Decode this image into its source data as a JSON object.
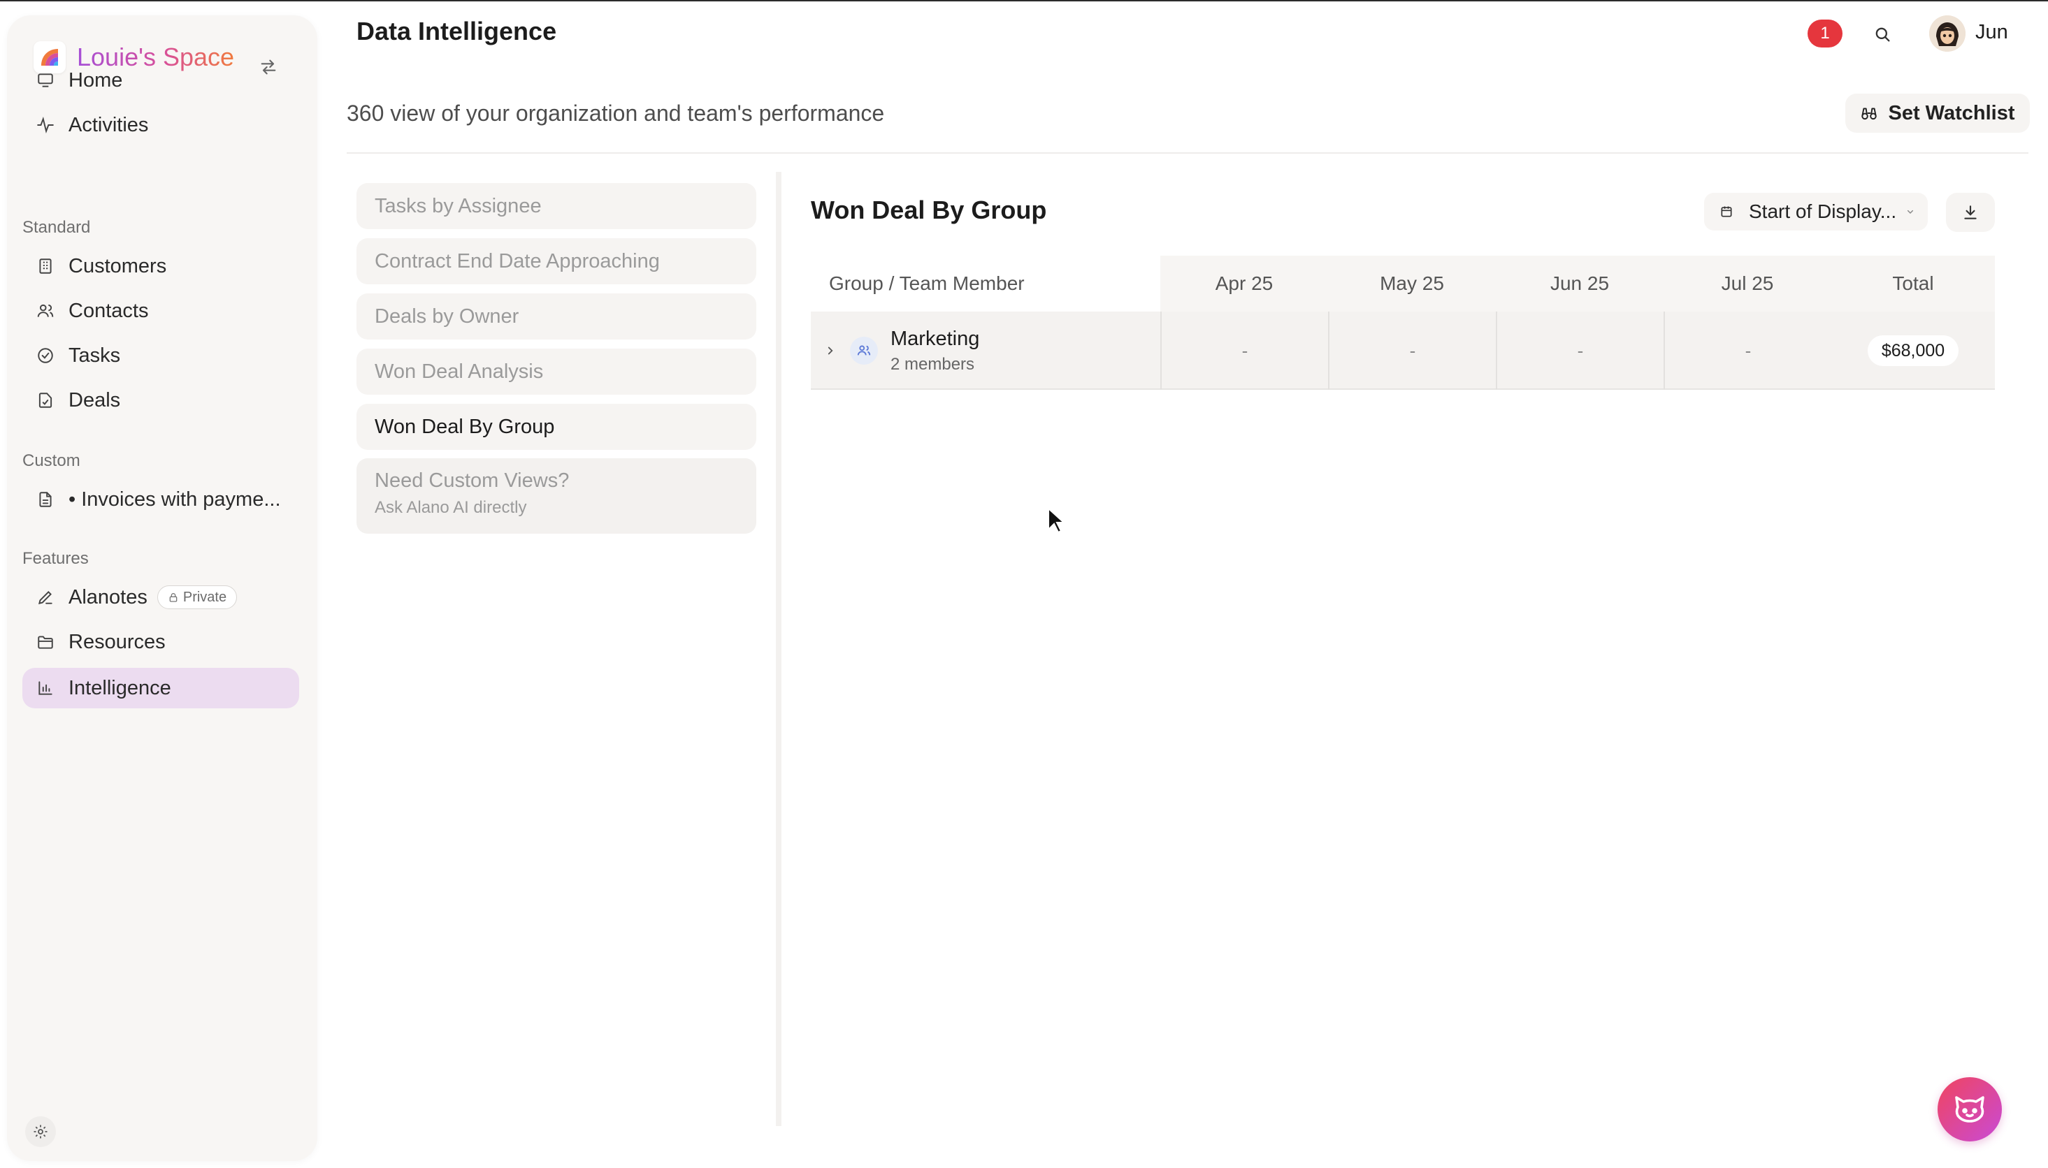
{
  "app": {
    "brand_name": "Louie's Space",
    "page_title": "Data Intelligence"
  },
  "header": {
    "notification_count": "1",
    "user_name": "Jun"
  },
  "sidebar": {
    "top_items": [
      {
        "label": "Home",
        "icon": "monitor-icon"
      },
      {
        "label": "Activities",
        "icon": "activity-icon"
      }
    ],
    "standard_label": "Standard",
    "standard_items": [
      {
        "label": "Customers",
        "icon": "building-icon"
      },
      {
        "label": "Contacts",
        "icon": "users-icon"
      },
      {
        "label": "Tasks",
        "icon": "check-circle-icon"
      },
      {
        "label": "Deals",
        "icon": "deal-doc-icon"
      }
    ],
    "custom_label": "Custom",
    "custom_items": [
      {
        "label": "• Invoices with payme...",
        "icon": "document-icon"
      }
    ],
    "features_label": "Features",
    "features_items": [
      {
        "label": "Alanotes",
        "icon": "pen-icon",
        "badge": "Private"
      },
      {
        "label": "Resources",
        "icon": "folder-icon"
      },
      {
        "label": "Intelligence",
        "icon": "bar-chart-icon",
        "active": true
      }
    ]
  },
  "main": {
    "subtitle": "360 view of your organization and team's performance",
    "watchlist_label": "Set Watchlist",
    "reports": [
      {
        "label": "Tasks by Assignee"
      },
      {
        "label": "Contract End Date Approaching"
      },
      {
        "label": "Deals by Owner"
      },
      {
        "label": "Won Deal Analysis"
      },
      {
        "label": "Won Deal By Group",
        "active": true
      }
    ],
    "custom_views": {
      "title": "Need Custom Views?",
      "subtitle": "Ask Alano AI directly"
    }
  },
  "report": {
    "title": "Won Deal By Group",
    "date_filter": "Start of Display...",
    "table": {
      "headers": [
        "Group / Team Member",
        "Apr 25",
        "May 25",
        "Jun 25",
        "Jul 25",
        "Total"
      ],
      "rows": [
        {
          "group": "Marketing",
          "members": "2 members",
          "values": [
            "-",
            "-",
            "-",
            "-"
          ],
          "total": "$68,000"
        }
      ]
    }
  },
  "colors": {
    "accent_active": "#ecdcf0",
    "notification": "#e5363d",
    "brand_gradient_start": "#a64fd6",
    "brand_gradient_end": "#f07a3d"
  }
}
